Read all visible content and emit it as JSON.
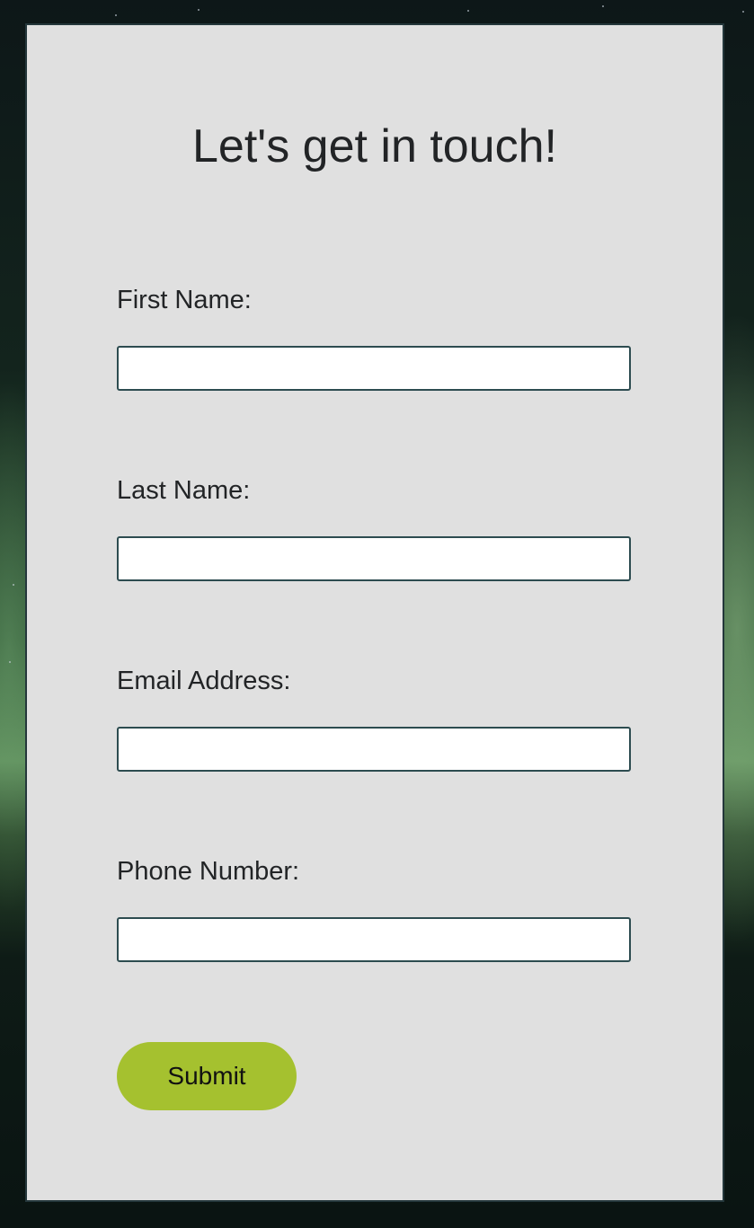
{
  "form": {
    "title": "Let's get in touch!",
    "fields": [
      {
        "label": "First Name:",
        "value": "",
        "placeholder": ""
      },
      {
        "label": "Last Name:",
        "value": "",
        "placeholder": ""
      },
      {
        "label": "Email Address:",
        "value": "",
        "placeholder": ""
      },
      {
        "label": "Phone Number:",
        "value": "",
        "placeholder": ""
      }
    ],
    "submit_label": "Submit"
  },
  "colors": {
    "card_background": "#e0e0e0",
    "card_border": "#24373b",
    "input_border": "#2d4c50",
    "submit_background": "#a5c12f",
    "text": "#222426"
  }
}
